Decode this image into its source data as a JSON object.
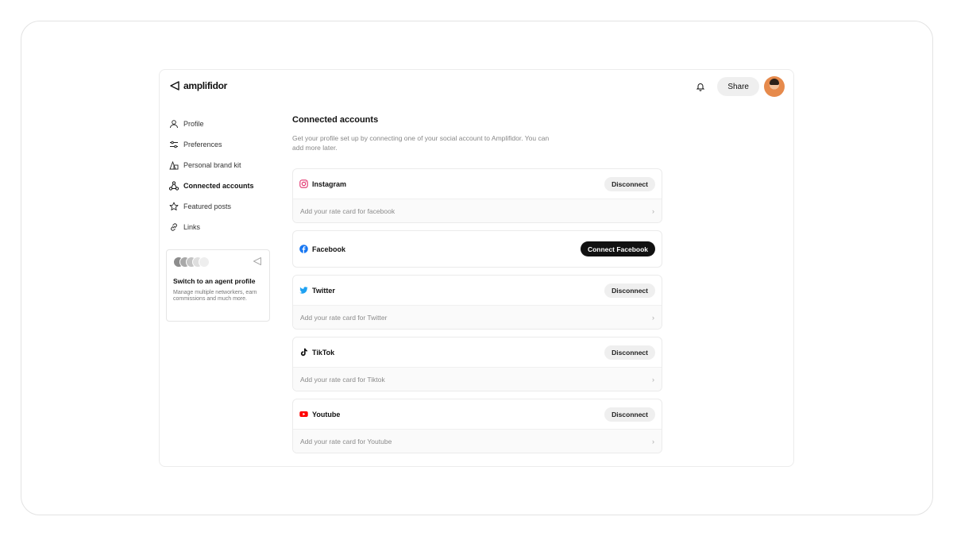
{
  "app": {
    "name": "amplifidor"
  },
  "header": {
    "share_label": "Share",
    "notification_icon": "bell-icon",
    "avatar_icon": "user-avatar"
  },
  "sidebar": {
    "items": [
      {
        "label": "Profile",
        "icon": "user-icon",
        "active": false
      },
      {
        "label": "Preferences",
        "icon": "sliders-icon",
        "active": false
      },
      {
        "label": "Personal brand kit",
        "icon": "shapes-icon",
        "active": false
      },
      {
        "label": "Connected accounts",
        "icon": "network-icon",
        "active": true
      },
      {
        "label": "Featured posts",
        "icon": "star-icon",
        "active": false
      },
      {
        "label": "Links",
        "icon": "link-icon",
        "active": false
      }
    ],
    "agent_card": {
      "title": "Switch to an agent profile",
      "description": "Manage multiple networkers, earn commissions and much more."
    }
  },
  "main": {
    "title": "Connected accounts",
    "description": "Get your profile set up by connecting one of your social account to Amplifidor. You can add more later.",
    "accounts": [
      {
        "name": "Instagram",
        "icon": "instagram-icon",
        "action": "Disconnect",
        "rate_card": "Add your rate card for facebook"
      },
      {
        "name": "Facebook",
        "icon": "facebook-icon",
        "action": "Connect Facebook",
        "rate_card": ""
      },
      {
        "name": "Twitter",
        "icon": "twitter-icon",
        "action": "Disconnect",
        "rate_card": "Add your rate card for Twitter"
      },
      {
        "name": "TikTok",
        "icon": "tiktok-icon",
        "action": "Disconnect",
        "rate_card": "Add your rate card for Tiktok"
      },
      {
        "name": "Youtube",
        "icon": "youtube-icon",
        "action": "Disconnect",
        "rate_card": "Add your rate card for Youtube"
      }
    ]
  },
  "colors": {
    "instagram": "#e1306c",
    "facebook": "#1877f2",
    "twitter": "#1da1f2",
    "youtube": "#ff0000",
    "primary_button": "#111111"
  }
}
